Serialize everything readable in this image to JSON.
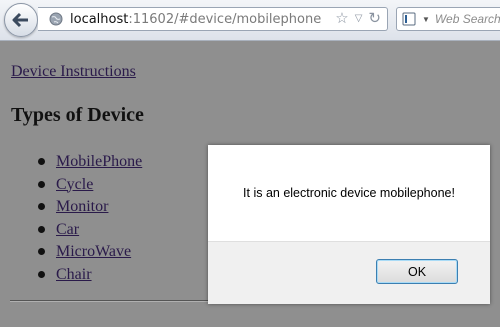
{
  "browser": {
    "url_host": "localhost",
    "url_rest": ":11602/#device/mobilephone",
    "search_placeholder": "Web Search",
    "icons": {
      "back": "back-arrow-icon",
      "site": "globe-icon",
      "bookmark": "star-icon",
      "history": "dropdown-triangle-icon",
      "reload": "reload-icon",
      "search_engine": "search-engine-icon"
    }
  },
  "page": {
    "link_label": "Device Instructions",
    "title": "Types of Device",
    "devices": [
      "MobilePhone",
      "Cycle",
      "Monitor",
      "Car",
      "MicroWave",
      "Chair"
    ]
  },
  "dialog": {
    "message": "It is an electronic device mobilephone!",
    "ok_label": "OK"
  },
  "colors": {
    "page_overlay": "#8f8f8f",
    "link": "#2a1a4a",
    "ok_border": "#3c7fb1"
  }
}
